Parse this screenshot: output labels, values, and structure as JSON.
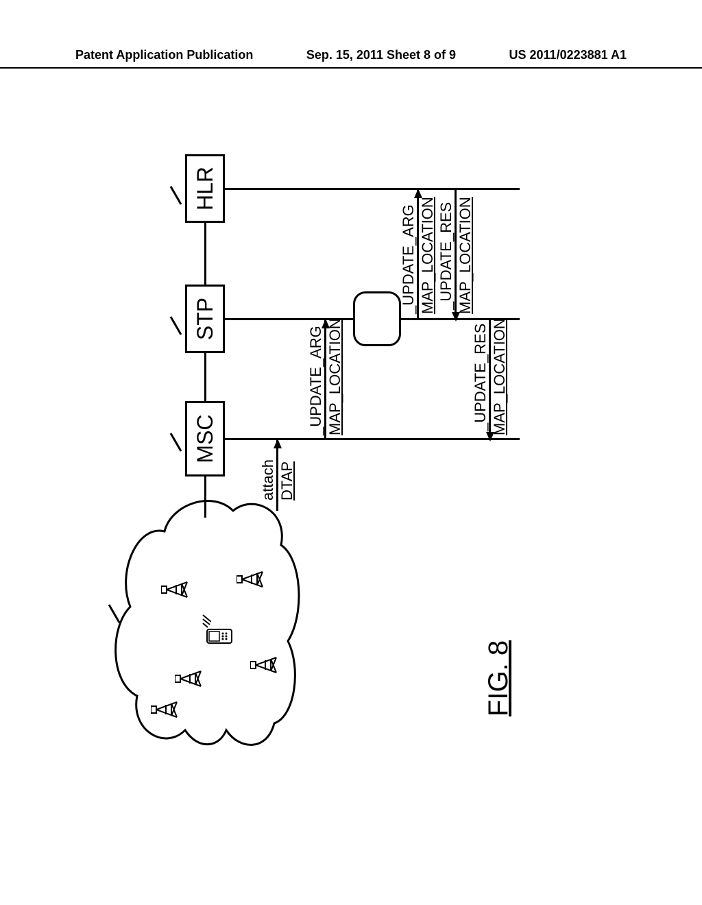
{
  "header": {
    "left": "Patent Application Publication",
    "center": "Sep. 15, 2011  Sheet 8 of 9",
    "right": "US 2011/0223881 A1"
  },
  "nodes": {
    "msc": "MSC",
    "stp": "STP",
    "hlr": "HLR"
  },
  "messages": {
    "attach": "attach",
    "dtap": "DTAP",
    "update_arg": "_UPDATE_ARG",
    "map_location": "MAP_LOCATION",
    "update_res": "_UPDATE_RES"
  },
  "figure_label": "FIG. 8"
}
